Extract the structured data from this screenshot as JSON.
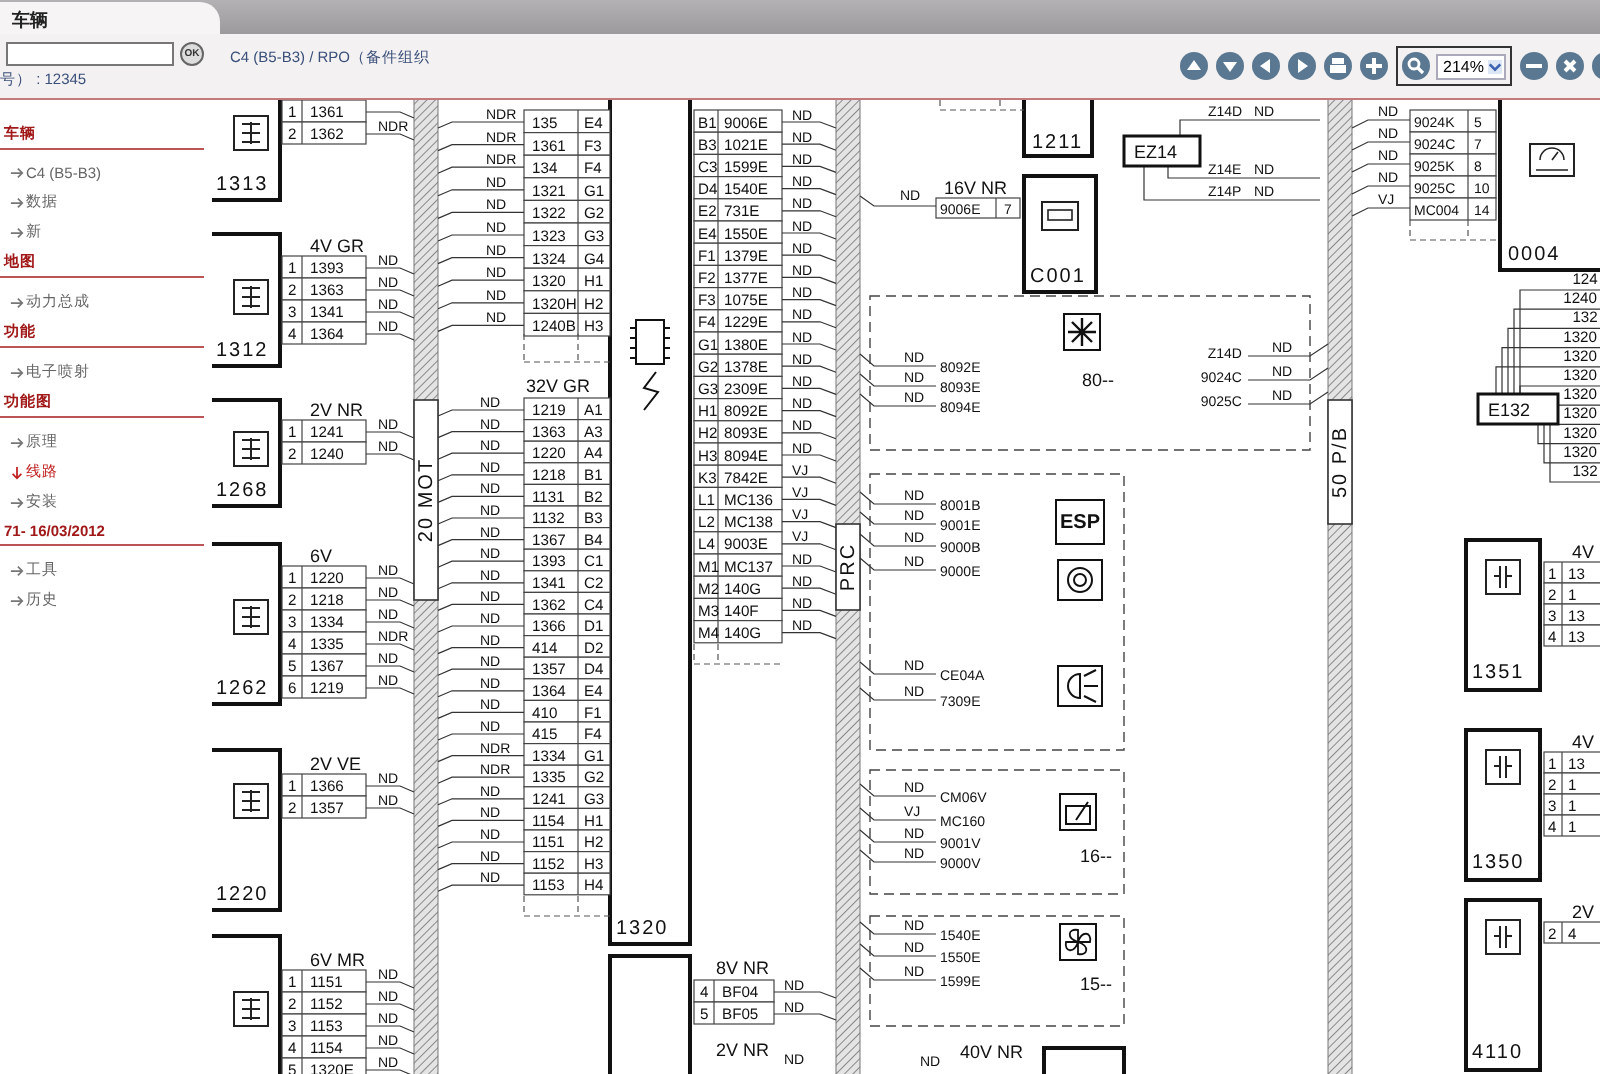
{
  "tab": {
    "label": "车辆",
    "selected": true
  },
  "ok_button": {
    "label": "OK"
  },
  "breadcrumb": "C4 (B5-B3) / RPO（备件组织",
  "vin_line": "号） : 12345",
  "toolbar": {
    "zoom": "214%"
  },
  "sidebar": [
    {
      "title": "车辆",
      "items": [
        {
          "label": "C4 (B5-B3)",
          "selected": false
        },
        {
          "label": "数据",
          "selected": false
        },
        {
          "label": "新",
          "selected": false
        }
      ]
    },
    {
      "title": "地图",
      "items": [
        {
          "label": "动力总成",
          "selected": false
        }
      ]
    },
    {
      "title": "功能",
      "items": [
        {
          "label": "电子喷射",
          "selected": false
        }
      ]
    },
    {
      "title": "功能图",
      "items": [
        {
          "label": "原理",
          "selected": false
        },
        {
          "label": "线路",
          "selected": true
        },
        {
          "label": "安装",
          "selected": false
        }
      ]
    },
    {
      "title": "71- 16/03/2012",
      "items": [
        {
          "label": "工具",
          "selected": false
        },
        {
          "label": "历史",
          "selected": false
        }
      ]
    }
  ],
  "diagram": {
    "left_connectors": [
      {
        "id": "1313",
        "pins": [
          {
            "pin": "1",
            "wire": "1361"
          },
          {
            "pin": "2",
            "wire": "1362",
            "signal": "NDR"
          }
        ]
      },
      {
        "id": "1312",
        "header": "4V GR",
        "pins": [
          {
            "pin": "1",
            "wire": "1393",
            "signal": "ND"
          },
          {
            "pin": "2",
            "wire": "1363",
            "signal": "ND"
          },
          {
            "pin": "3",
            "wire": "1341",
            "signal": "ND"
          },
          {
            "pin": "4",
            "wire": "1364",
            "signal": "ND"
          }
        ]
      },
      {
        "id": "1268",
        "header": "2V NR",
        "pins": [
          {
            "pin": "1",
            "wire": "1241",
            "signal": "ND"
          },
          {
            "pin": "2",
            "wire": "1240",
            "signal": "ND"
          }
        ]
      },
      {
        "id": "1262",
        "header": "6V",
        "pins": [
          {
            "pin": "1",
            "wire": "1220",
            "signal": "ND"
          },
          {
            "pin": "2",
            "wire": "1218",
            "signal": "ND"
          },
          {
            "pin": "3",
            "wire": "1334",
            "signal": "ND"
          },
          {
            "pin": "4",
            "wire": "1335",
            "signal": "NDR"
          },
          {
            "pin": "5",
            "wire": "1367",
            "signal": "ND"
          },
          {
            "pin": "6",
            "wire": "1219",
            "signal": "ND"
          }
        ]
      },
      {
        "id": "1220",
        "header": "2V VE",
        "pins": [
          {
            "pin": "1",
            "wire": "1366",
            "signal": "ND"
          },
          {
            "pin": "2",
            "wire": "1357",
            "signal": "ND"
          }
        ]
      },
      {
        "header": "6V MR",
        "pins": [
          {
            "pin": "1",
            "wire": "1151",
            "signal": "ND"
          },
          {
            "pin": "2",
            "wire": "1152",
            "signal": "ND"
          },
          {
            "pin": "3",
            "wire": "1153",
            "signal": "ND"
          },
          {
            "pin": "4",
            "wire": "1154",
            "signal": "ND"
          },
          {
            "pin": "5",
            "wire": "1320E",
            "signal": "ND"
          }
        ]
      }
    ],
    "buses": [
      {
        "label": "20 MOT"
      },
      {
        "label": "PRC"
      },
      {
        "label": "50 P/B"
      }
    ],
    "ecu": {
      "id": "1320",
      "upper_pins": [
        {
          "signal": "NDR",
          "wire": "135",
          "pin": "E4"
        },
        {
          "signal": "NDR",
          "wire": "1361",
          "pin": "F3"
        },
        {
          "signal": "NDR",
          "wire": "134",
          "pin": "F4"
        },
        {
          "signal": "ND",
          "wire": "1321",
          "pin": "G1"
        },
        {
          "signal": "ND",
          "wire": "1322",
          "pin": "G2"
        },
        {
          "signal": "ND",
          "wire": "1323",
          "pin": "G3"
        },
        {
          "signal": "ND",
          "wire": "1324",
          "pin": "G4"
        },
        {
          "signal": "ND",
          "wire": "1320",
          "pin": "H1"
        },
        {
          "signal": "ND",
          "wire": "1320H",
          "pin": "H2"
        },
        {
          "signal": "ND",
          "wire": "1240B",
          "pin": "H3"
        }
      ],
      "lower_header": "32V GR",
      "lower_pins": [
        {
          "signal": "ND",
          "wire": "1219",
          "pin": "A1"
        },
        {
          "signal": "ND",
          "wire": "1363",
          "pin": "A3"
        },
        {
          "signal": "ND",
          "wire": "1220",
          "pin": "A4"
        },
        {
          "signal": "ND",
          "wire": "1218",
          "pin": "B1"
        },
        {
          "signal": "ND",
          "wire": "1131",
          "pin": "B2"
        },
        {
          "signal": "ND",
          "wire": "1132",
          "pin": "B3"
        },
        {
          "signal": "ND",
          "wire": "1367",
          "pin": "B4"
        },
        {
          "signal": "ND",
          "wire": "1393",
          "pin": "C1"
        },
        {
          "signal": "ND",
          "wire": "1341",
          "pin": "C2"
        },
        {
          "signal": "ND",
          "wire": "1362",
          "pin": "C4"
        },
        {
          "signal": "ND",
          "wire": "1366",
          "pin": "D1"
        },
        {
          "signal": "ND",
          "wire": "414",
          "pin": "D2"
        },
        {
          "signal": "ND",
          "wire": "1357",
          "pin": "D4"
        },
        {
          "signal": "ND",
          "wire": "1364",
          "pin": "E4"
        },
        {
          "signal": "ND",
          "wire": "410",
          "pin": "F1"
        },
        {
          "signal": "ND",
          "wire": "415",
          "pin": "F4"
        },
        {
          "signal": "NDR",
          "wire": "1334",
          "pin": "G1"
        },
        {
          "signal": "NDR",
          "wire": "1335",
          "pin": "G2"
        },
        {
          "signal": "ND",
          "wire": "1241",
          "pin": "G3"
        },
        {
          "signal": "ND",
          "wire": "1154",
          "pin": "H1"
        },
        {
          "signal": "ND",
          "wire": "1151",
          "pin": "H2"
        },
        {
          "signal": "ND",
          "wire": "1152",
          "pin": "H3"
        },
        {
          "signal": "ND",
          "wire": "1153",
          "pin": "H4"
        }
      ],
      "right_pins": [
        {
          "pin": "B1",
          "wire": "9006E",
          "signal": "ND"
        },
        {
          "pin": "B3",
          "wire": "1021E",
          "signal": "ND"
        },
        {
          "pin": "C3",
          "wire": "1599E",
          "signal": "ND"
        },
        {
          "pin": "D4",
          "wire": "1540E",
          "signal": "ND"
        },
        {
          "pin": "E2",
          "wire": "731E",
          "signal": "ND"
        },
        {
          "pin": "E4",
          "wire": "1550E",
          "signal": "ND"
        },
        {
          "pin": "F1",
          "wire": "1379E",
          "signal": "ND"
        },
        {
          "pin": "F2",
          "wire": "1377E",
          "signal": "ND"
        },
        {
          "pin": "F3",
          "wire": "1075E",
          "signal": "ND"
        },
        {
          "pin": "F4",
          "wire": "1229E",
          "signal": "ND"
        },
        {
          "pin": "G1",
          "wire": "1380E",
          "signal": "ND"
        },
        {
          "pin": "G2",
          "wire": "1378E",
          "signal": "ND"
        },
        {
          "pin": "G3",
          "wire": "2309E",
          "signal": "ND"
        },
        {
          "pin": "H1",
          "wire": "8092E",
          "signal": "ND"
        },
        {
          "pin": "H2",
          "wire": "8093E",
          "signal": "ND"
        },
        {
          "pin": "H3",
          "wire": "8094E",
          "signal": "ND"
        },
        {
          "pin": "K3",
          "wire": "7842E",
          "signal": "VJ"
        },
        {
          "pin": "L1",
          "wire": "MC136",
          "signal": "VJ"
        },
        {
          "pin": "L2",
          "wire": "MC138",
          "signal": "VJ"
        },
        {
          "pin": "L4",
          "wire": "9003E",
          "signal": "VJ"
        },
        {
          "pin": "M1",
          "wire": "MC137",
          "signal": "ND"
        },
        {
          "pin": "M2",
          "wire": "140G",
          "signal": "ND"
        },
        {
          "pin": "M3",
          "wire": "140F",
          "signal": "ND"
        },
        {
          "pin": "M4",
          "wire": "140G",
          "signal": "ND"
        }
      ]
    },
    "ecu_lower": {
      "header": "8V NR",
      "pins": [
        {
          "pin": "4",
          "wire": "BF04",
          "signal": "ND"
        },
        {
          "pin": "5",
          "wire": "BF05",
          "signal": "ND"
        }
      ],
      "sub_header": "2V NR",
      "sub_signal": "ND"
    },
    "box_1211": "1211",
    "splice_ez14": {
      "id": "EZ14",
      "legs": [
        {
          "wire": "Z14D",
          "signal": "ND"
        },
        {
          "wire": "Z14E",
          "signal": "ND"
        },
        {
          "wire": "Z14P",
          "signal": "ND"
        }
      ]
    },
    "diag_socket": {
      "id": "C001",
      "header": "16V NR",
      "wire": "9006E",
      "pin": "7",
      "signal": "ND"
    },
    "groups": [
      {
        "code": "80--",
        "left": [
          {
            "signal": "ND",
            "wire": "8092E"
          },
          {
            "signal": "ND",
            "wire": "8093E"
          },
          {
            "signal": "ND",
            "wire": "8094E"
          }
        ],
        "right": [
          {
            "wire": "Z14D",
            "signal": "ND"
          },
          {
            "wire": "9024C",
            "signal": "ND"
          },
          {
            "wire": "9025C",
            "signal": "ND"
          }
        ]
      },
      {
        "badge": "ESP",
        "left": [
          {
            "signal": "ND",
            "wire": "8001B"
          },
          {
            "signal": "ND",
            "wire": "9001E"
          },
          {
            "signal": "ND",
            "wire": "9000B"
          },
          {
            "signal": "ND",
            "wire": "9000E"
          },
          {
            "signal": "ND",
            "wire": "CE04A"
          },
          {
            "signal": "ND",
            "wire": "7309E"
          }
        ]
      },
      {
        "code": "16--",
        "left": [
          {
            "signal": "ND",
            "wire": "CM06V"
          },
          {
            "signal": "VJ",
            "wire": "MC160"
          },
          {
            "signal": "ND",
            "wire": "9001V"
          },
          {
            "signal": "ND",
            "wire": "9000V"
          }
        ]
      },
      {
        "code": "15--",
        "left": [
          {
            "signal": "ND",
            "wire": "1540E"
          },
          {
            "signal": "ND",
            "wire": "1550E"
          },
          {
            "signal": "ND",
            "wire": "1599E"
          }
        ]
      }
    ],
    "connector_40v": {
      "header": "40V NR",
      "signal": "ND"
    },
    "cluster": {
      "id": "0004",
      "pins": [
        {
          "signal": "ND",
          "wire": "9024K",
          "pin": "5"
        },
        {
          "signal": "ND",
          "wire": "9024C",
          "pin": "7"
        },
        {
          "signal": "ND",
          "wire": "9025K",
          "pin": "8"
        },
        {
          "signal": "ND",
          "wire": "9025C",
          "pin": "10"
        },
        {
          "signal": "VJ",
          "wire": "MC004",
          "pin": "14"
        }
      ]
    },
    "splice_e132": {
      "id": "E132",
      "legs": [
        "124",
        "1240",
        "132",
        "1320",
        "1320",
        "1320",
        "1320",
        "1320",
        "1320",
        "1320",
        "132"
      ]
    },
    "right_connectors": [
      {
        "id": "1351",
        "header": "4V",
        "pins": [
          {
            "pin": "1",
            "wire": "13"
          },
          {
            "pin": "2",
            "wire": "1"
          },
          {
            "pin": "3",
            "wire": "13"
          },
          {
            "pin": "4",
            "wire": "13"
          }
        ]
      },
      {
        "id": "1350",
        "header": "4V",
        "pins": [
          {
            "pin": "1",
            "wire": "13"
          },
          {
            "pin": "2",
            "wire": "1"
          },
          {
            "pin": "3",
            "wire": "1"
          },
          {
            "pin": "4",
            "wire": "1"
          }
        ]
      },
      {
        "id": "4110",
        "header": "2V",
        "pins": [
          {
            "pin": "2",
            "wire": "4"
          }
        ]
      }
    ]
  }
}
